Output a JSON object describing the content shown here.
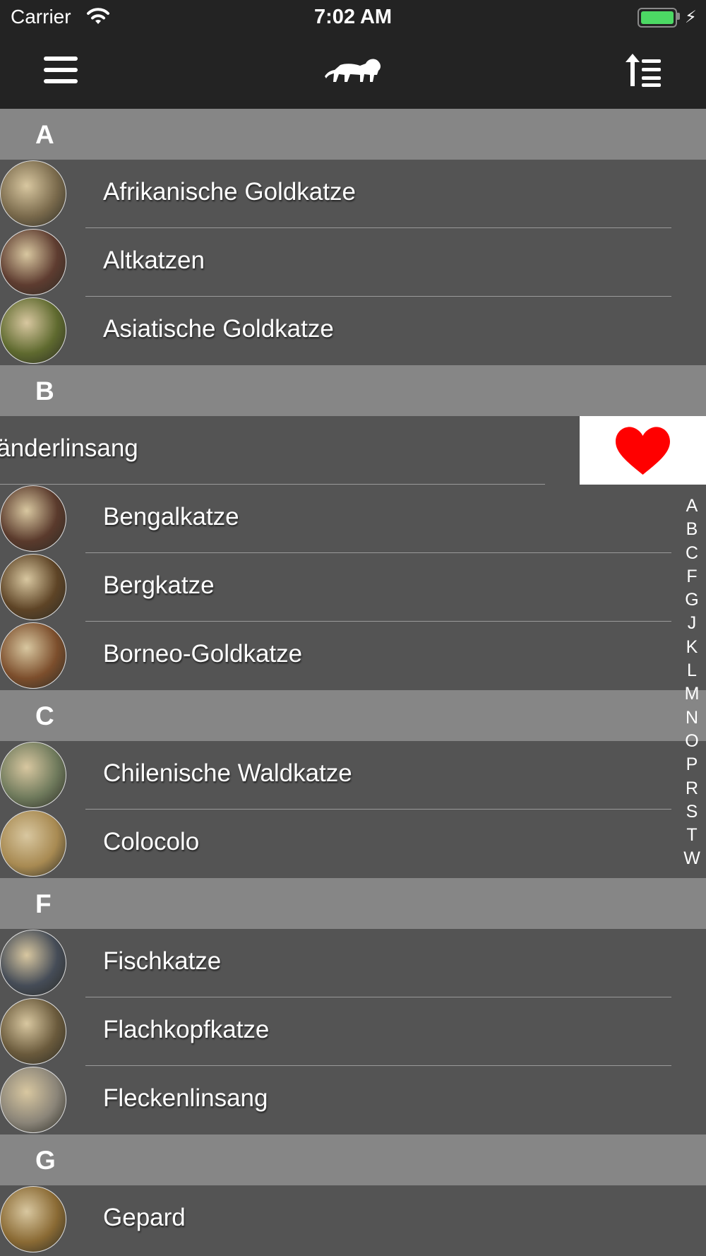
{
  "status_bar": {
    "carrier": "Carrier",
    "time": "7:02 AM"
  },
  "nav": {
    "menu_icon": "hamburger-icon",
    "logo_icon": "lion-icon",
    "sort_icon": "sort-ascending-icon"
  },
  "colors": {
    "nav_bg": "#232323",
    "section_bg": "#868686",
    "row_bg": "#545454",
    "favorite": "#ff0000",
    "battery": "#4cd964"
  },
  "sections": [
    {
      "letter": "A",
      "items": [
        {
          "name": "Afrikanische Goldkatze",
          "thumb": "#7a6a4c"
        },
        {
          "name": "Altkatzen",
          "thumb": "#5e3c30"
        },
        {
          "name": "Asiatische Goldkatze",
          "thumb": "#5f6a2f"
        }
      ]
    },
    {
      "letter": "B",
      "items": [
        {
          "name": "Bänderlinsang",
          "swiped": true,
          "action_icon": "heart-icon"
        },
        {
          "name": "Bengalkatze",
          "thumb": "#5a3a2c"
        },
        {
          "name": "Bergkatze",
          "thumb": "#5e4426"
        },
        {
          "name": "Borneo-Goldkatze",
          "thumb": "#7c4e2c"
        }
      ]
    },
    {
      "letter": "C",
      "items": [
        {
          "name": "Chilenische Waldkatze",
          "thumb": "#6f7a5c"
        },
        {
          "name": "Colocolo",
          "thumb": "#a88a52"
        }
      ]
    },
    {
      "letter": "F",
      "items": [
        {
          "name": "Fischkatze",
          "thumb": "#454c57"
        },
        {
          "name": "Flachkopfkatze",
          "thumb": "#6a5a3c"
        },
        {
          "name": "Fleckenlinsang",
          "thumb": "#8a8478"
        }
      ]
    },
    {
      "letter": "G",
      "items": [
        {
          "name": "Gepard",
          "thumb": "#8a6a34"
        }
      ]
    }
  ],
  "index": [
    "A",
    "B",
    "C",
    "F",
    "G",
    "J",
    "K",
    "L",
    "M",
    "N",
    "O",
    "P",
    "R",
    "S",
    "T",
    "W"
  ]
}
